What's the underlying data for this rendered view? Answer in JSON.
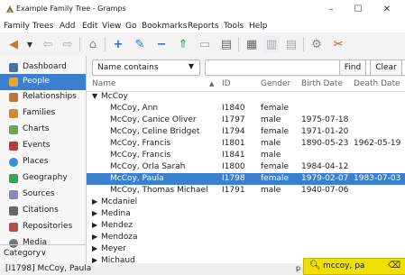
{
  "window": {
    "title": "Example Family Tree - Gramps",
    "minimize": "–",
    "maximize": "☐",
    "close": "✕"
  },
  "menu": [
    "Family Trees",
    "Add",
    "Edit",
    "View",
    "Go",
    "Bookmarks",
    "Reports",
    "Tools",
    "Help"
  ],
  "sidebar": {
    "items": [
      {
        "label": "Dashboard",
        "icon": "dashboard-icon",
        "color": "#4a6fa5"
      },
      {
        "label": "People",
        "icon": "people-icon",
        "color": "#e6a23c"
      },
      {
        "label": "Relationships",
        "icon": "relationships-icon",
        "color": "#c0763a"
      },
      {
        "label": "Families",
        "icon": "families-icon",
        "color": "#d08a3a"
      },
      {
        "label": "Charts",
        "icon": "charts-icon",
        "color": "#6aa84f"
      },
      {
        "label": "Events",
        "icon": "events-icon",
        "color": "#b04040"
      },
      {
        "label": "Places",
        "icon": "places-icon",
        "color": "#3a8fd0"
      },
      {
        "label": "Geography",
        "icon": "geography-icon",
        "color": "#3aa05a"
      },
      {
        "label": "Sources",
        "icon": "sources-icon",
        "color": "#8a8ac0"
      },
      {
        "label": "Citations",
        "icon": "citations-icon",
        "color": "#666666"
      },
      {
        "label": "Repositories",
        "icon": "repositories-icon",
        "color": "#b05050"
      },
      {
        "label": "Media",
        "icon": "media-icon",
        "color": "#777777"
      }
    ],
    "active": "People",
    "category": "Category∨"
  },
  "filter": {
    "combo": "Name contains",
    "search_value": "",
    "find": "Find",
    "clear": "Clear"
  },
  "table": {
    "columns": [
      "Name",
      "ID",
      "Gender",
      "Birth Date",
      "Death Date"
    ],
    "group": "McCoy",
    "rows": [
      {
        "name": "McCoy, Ann",
        "id": "I1840",
        "gender": "female",
        "birth": "",
        "death": ""
      },
      {
        "name": "McCoy, Canice Oliver",
        "id": "I1797",
        "gender": "male",
        "birth": "1975-07-18",
        "death": ""
      },
      {
        "name": "McCoy, Celine Bridget",
        "id": "I1794",
        "gender": "female",
        "birth": "1971-01-20",
        "death": ""
      },
      {
        "name": "McCoy, Francis",
        "id": "I1801",
        "gender": "male",
        "birth": "1890-05-23",
        "death": "1962-05-19"
      },
      {
        "name": "McCoy, Francis",
        "id": "I1841",
        "gender": "male",
        "birth": "",
        "death": ""
      },
      {
        "name": "McCoy, Orla Sarah",
        "id": "I1800",
        "gender": "female",
        "birth": "1984-04-12",
        "death": ""
      },
      {
        "name": "McCoy, Paula",
        "id": "I1798",
        "gender": "female",
        "birth": "1979-02-07",
        "death": "1983-07-03"
      },
      {
        "name": "McCoy, Thomas Michael",
        "id": "I1791",
        "gender": "male",
        "birth": "1940-07-06",
        "death": ""
      }
    ],
    "selected_index": 6,
    "collapsed_groups": [
      "Mcdaniel",
      "Medina",
      "Mendez",
      "Mendoza",
      "Meyer",
      "Michaud"
    ]
  },
  "status": {
    "text": "[I1798] McCoy, Paula",
    "p_label": "p"
  },
  "quicksearch": {
    "value": "mccoy, pa"
  }
}
